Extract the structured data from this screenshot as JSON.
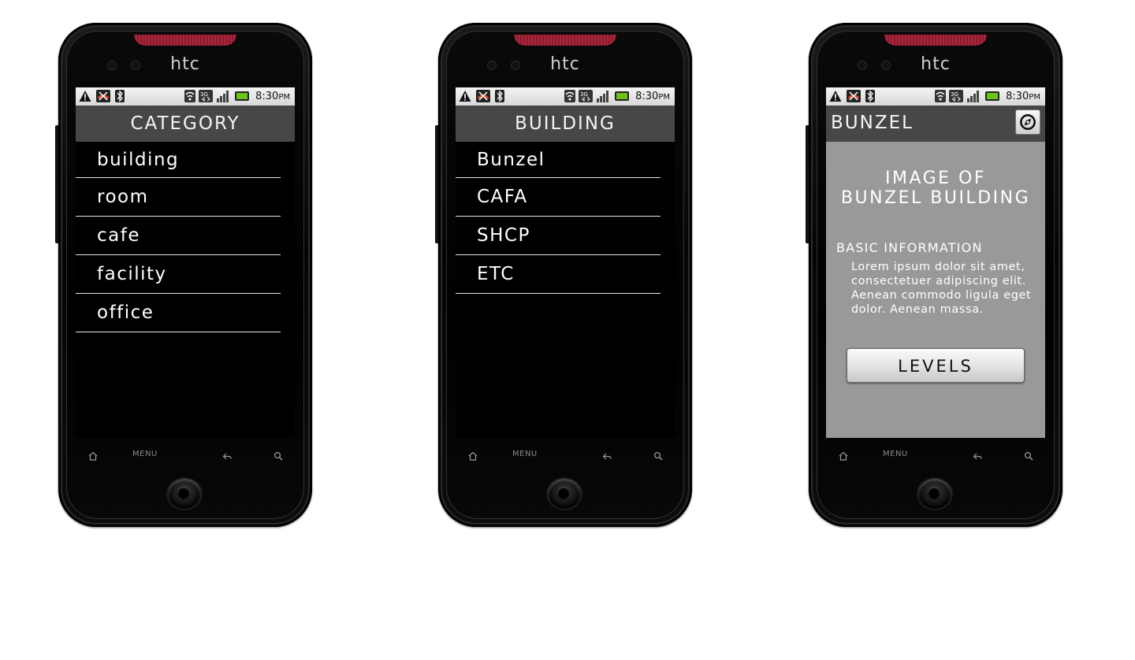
{
  "colors": {
    "titlebar": "#474745",
    "detail_bg": "#999999",
    "speaker": "#a8283c"
  },
  "phones": [
    {
      "brand": "htc",
      "status": {
        "time": "8:30",
        "ampm": "PM"
      },
      "title": "CATEGORY",
      "items": [
        "building",
        "room",
        "cafe",
        "facility",
        "office"
      ],
      "softkeys": {
        "menu": "MENU"
      }
    },
    {
      "brand": "htc",
      "status": {
        "time": "8:30",
        "ampm": "PM"
      },
      "title": "BUILDING",
      "items": [
        "Bunzel",
        "CAFA",
        "SHCP",
        "ETC"
      ],
      "softkeys": {
        "menu": "MENU"
      }
    },
    {
      "brand": "htc",
      "status": {
        "time": "8:30",
        "ampm": "PM"
      },
      "title": "BUNZEL",
      "image_caption_line1": "IMAGE OF",
      "image_caption_line2": "BUNZEL BUILDING",
      "info_heading": "BASIC INFORMATION",
      "info_text": "Lorem ipsum dolor sit amet, consectetuer adipiscing elit. Aenean commodo ligula eget dolor. Aenean massa.",
      "button_label": "LEVELS",
      "softkeys": {
        "menu": "MENU"
      }
    }
  ],
  "icons": [
    "warning-icon",
    "missed-call-icon",
    "bluetooth-icon",
    "wifi-icon",
    "3g-icon",
    "signal-icon",
    "battery-icon",
    "compass-icon",
    "home-icon",
    "back-icon",
    "search-icon"
  ]
}
